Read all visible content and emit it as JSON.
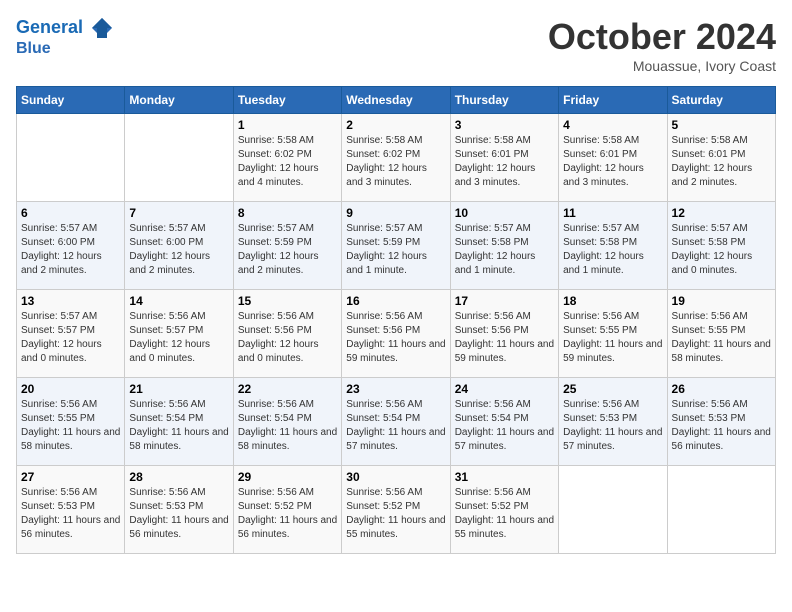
{
  "header": {
    "logo_line1": "General",
    "logo_line2": "Blue",
    "month_title": "October 2024",
    "location": "Mouassue, Ivory Coast"
  },
  "weekdays": [
    "Sunday",
    "Monday",
    "Tuesday",
    "Wednesday",
    "Thursday",
    "Friday",
    "Saturday"
  ],
  "weeks": [
    [
      {
        "day": "",
        "detail": ""
      },
      {
        "day": "",
        "detail": ""
      },
      {
        "day": "1",
        "detail": "Sunrise: 5:58 AM\nSunset: 6:02 PM\nDaylight: 12 hours and 4 minutes."
      },
      {
        "day": "2",
        "detail": "Sunrise: 5:58 AM\nSunset: 6:02 PM\nDaylight: 12 hours and 3 minutes."
      },
      {
        "day": "3",
        "detail": "Sunrise: 5:58 AM\nSunset: 6:01 PM\nDaylight: 12 hours and 3 minutes."
      },
      {
        "day": "4",
        "detail": "Sunrise: 5:58 AM\nSunset: 6:01 PM\nDaylight: 12 hours and 3 minutes."
      },
      {
        "day": "5",
        "detail": "Sunrise: 5:58 AM\nSunset: 6:01 PM\nDaylight: 12 hours and 2 minutes."
      }
    ],
    [
      {
        "day": "6",
        "detail": "Sunrise: 5:57 AM\nSunset: 6:00 PM\nDaylight: 12 hours and 2 minutes."
      },
      {
        "day": "7",
        "detail": "Sunrise: 5:57 AM\nSunset: 6:00 PM\nDaylight: 12 hours and 2 minutes."
      },
      {
        "day": "8",
        "detail": "Sunrise: 5:57 AM\nSunset: 5:59 PM\nDaylight: 12 hours and 2 minutes."
      },
      {
        "day": "9",
        "detail": "Sunrise: 5:57 AM\nSunset: 5:59 PM\nDaylight: 12 hours and 1 minute."
      },
      {
        "day": "10",
        "detail": "Sunrise: 5:57 AM\nSunset: 5:58 PM\nDaylight: 12 hours and 1 minute."
      },
      {
        "day": "11",
        "detail": "Sunrise: 5:57 AM\nSunset: 5:58 PM\nDaylight: 12 hours and 1 minute."
      },
      {
        "day": "12",
        "detail": "Sunrise: 5:57 AM\nSunset: 5:58 PM\nDaylight: 12 hours and 0 minutes."
      }
    ],
    [
      {
        "day": "13",
        "detail": "Sunrise: 5:57 AM\nSunset: 5:57 PM\nDaylight: 12 hours and 0 minutes."
      },
      {
        "day": "14",
        "detail": "Sunrise: 5:56 AM\nSunset: 5:57 PM\nDaylight: 12 hours and 0 minutes."
      },
      {
        "day": "15",
        "detail": "Sunrise: 5:56 AM\nSunset: 5:56 PM\nDaylight: 12 hours and 0 minutes."
      },
      {
        "day": "16",
        "detail": "Sunrise: 5:56 AM\nSunset: 5:56 PM\nDaylight: 11 hours and 59 minutes."
      },
      {
        "day": "17",
        "detail": "Sunrise: 5:56 AM\nSunset: 5:56 PM\nDaylight: 11 hours and 59 minutes."
      },
      {
        "day": "18",
        "detail": "Sunrise: 5:56 AM\nSunset: 5:55 PM\nDaylight: 11 hours and 59 minutes."
      },
      {
        "day": "19",
        "detail": "Sunrise: 5:56 AM\nSunset: 5:55 PM\nDaylight: 11 hours and 58 minutes."
      }
    ],
    [
      {
        "day": "20",
        "detail": "Sunrise: 5:56 AM\nSunset: 5:55 PM\nDaylight: 11 hours and 58 minutes."
      },
      {
        "day": "21",
        "detail": "Sunrise: 5:56 AM\nSunset: 5:54 PM\nDaylight: 11 hours and 58 minutes."
      },
      {
        "day": "22",
        "detail": "Sunrise: 5:56 AM\nSunset: 5:54 PM\nDaylight: 11 hours and 58 minutes."
      },
      {
        "day": "23",
        "detail": "Sunrise: 5:56 AM\nSunset: 5:54 PM\nDaylight: 11 hours and 57 minutes."
      },
      {
        "day": "24",
        "detail": "Sunrise: 5:56 AM\nSunset: 5:54 PM\nDaylight: 11 hours and 57 minutes."
      },
      {
        "day": "25",
        "detail": "Sunrise: 5:56 AM\nSunset: 5:53 PM\nDaylight: 11 hours and 57 minutes."
      },
      {
        "day": "26",
        "detail": "Sunrise: 5:56 AM\nSunset: 5:53 PM\nDaylight: 11 hours and 56 minutes."
      }
    ],
    [
      {
        "day": "27",
        "detail": "Sunrise: 5:56 AM\nSunset: 5:53 PM\nDaylight: 11 hours and 56 minutes."
      },
      {
        "day": "28",
        "detail": "Sunrise: 5:56 AM\nSunset: 5:53 PM\nDaylight: 11 hours and 56 minutes."
      },
      {
        "day": "29",
        "detail": "Sunrise: 5:56 AM\nSunset: 5:52 PM\nDaylight: 11 hours and 56 minutes."
      },
      {
        "day": "30",
        "detail": "Sunrise: 5:56 AM\nSunset: 5:52 PM\nDaylight: 11 hours and 55 minutes."
      },
      {
        "day": "31",
        "detail": "Sunrise: 5:56 AM\nSunset: 5:52 PM\nDaylight: 11 hours and 55 minutes."
      },
      {
        "day": "",
        "detail": ""
      },
      {
        "day": "",
        "detail": ""
      }
    ]
  ]
}
